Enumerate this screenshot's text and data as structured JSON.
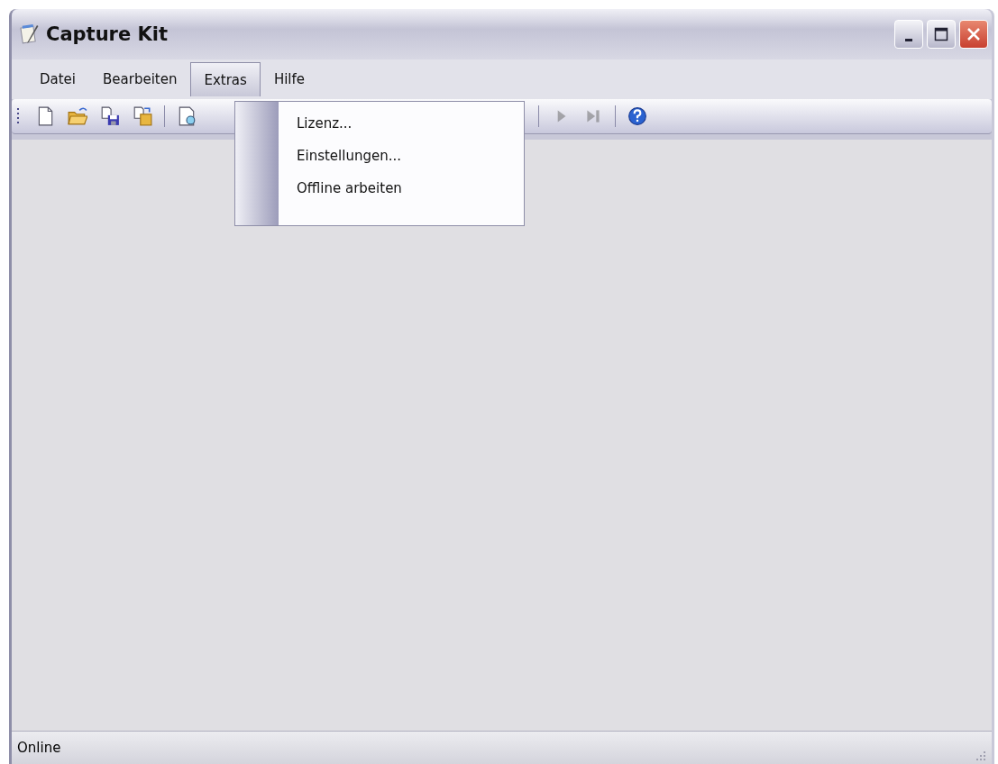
{
  "window": {
    "title": "Capture Kit"
  },
  "menu": [
    {
      "label": "Datei",
      "selected": false
    },
    {
      "label": "Bearbeiten",
      "selected": false
    },
    {
      "label": "Extras",
      "selected": true
    },
    {
      "label": "Hilfe",
      "selected": false
    }
  ],
  "dropdown": {
    "items": [
      {
        "label": "Lizenz..."
      },
      {
        "label": "Einstellungen..."
      },
      {
        "label": "Offline arbeiten"
      }
    ]
  },
  "toolbar": [
    {
      "kind": "new",
      "disabled": false
    },
    {
      "kind": "open",
      "disabled": false
    },
    {
      "kind": "saveas",
      "disabled": false
    },
    {
      "kind": "paste",
      "disabled": false
    },
    {
      "kind": "separator"
    },
    {
      "kind": "preview",
      "disabled": false
    },
    {
      "kind": "gap"
    },
    {
      "kind": "separator"
    },
    {
      "kind": "play",
      "disabled": true
    },
    {
      "kind": "end",
      "disabled": true
    },
    {
      "kind": "separator"
    },
    {
      "kind": "help",
      "disabled": false
    }
  ],
  "status_bar": {
    "text": "Online"
  }
}
